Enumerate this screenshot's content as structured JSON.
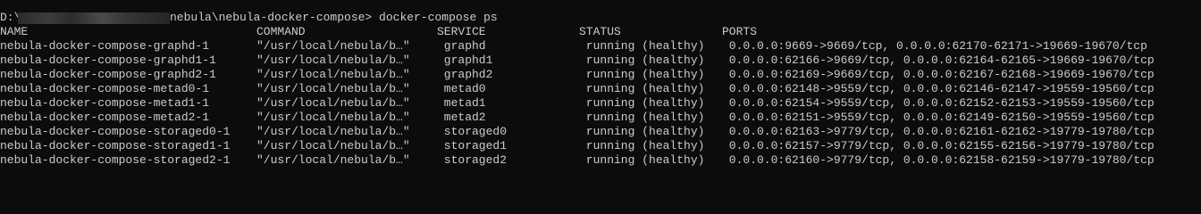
{
  "prompt": {
    "drive": "D:\\",
    "path_rest": "nebula\\nebula-docker-compose>",
    "command": " docker-compose ps"
  },
  "table": {
    "headers": {
      "name": "NAME",
      "command": "COMMAND",
      "service": "SERVICE",
      "status": "STATUS",
      "ports": "PORTS"
    },
    "rows": [
      {
        "name": "nebula-docker-compose-graphd-1",
        "command": "\"/usr/local/nebula/b…\"",
        "service": " graphd",
        "status": " running (healthy)",
        "ports": " 0.0.0.0:9669->9669/tcp, 0.0.0.0:62170-62171->19669-19670/tcp"
      },
      {
        "name": "nebula-docker-compose-graphd1-1",
        "command": "\"/usr/local/nebula/b…\"",
        "service": " graphd1",
        "status": " running (healthy)",
        "ports": " 0.0.0.0:62166->9669/tcp, 0.0.0.0:62164-62165->19669-19670/tcp"
      },
      {
        "name": "nebula-docker-compose-graphd2-1",
        "command": "\"/usr/local/nebula/b…\"",
        "service": " graphd2",
        "status": " running (healthy)",
        "ports": " 0.0.0.0:62169->9669/tcp, 0.0.0.0:62167-62168->19669-19670/tcp"
      },
      {
        "name": "nebula-docker-compose-metad0-1",
        "command": "\"/usr/local/nebula/b…\"",
        "service": " metad0",
        "status": " running (healthy)",
        "ports": " 0.0.0.0:62148->9559/tcp, 0.0.0.0:62146-62147->19559-19560/tcp"
      },
      {
        "name": "nebula-docker-compose-metad1-1",
        "command": "\"/usr/local/nebula/b…\"",
        "service": " metad1",
        "status": " running (healthy)",
        "ports": " 0.0.0.0:62154->9559/tcp, 0.0.0.0:62152-62153->19559-19560/tcp"
      },
      {
        "name": "nebula-docker-compose-metad2-1",
        "command": "\"/usr/local/nebula/b…\"",
        "service": " metad2",
        "status": " running (healthy)",
        "ports": " 0.0.0.0:62151->9559/tcp, 0.0.0.0:62149-62150->19559-19560/tcp"
      },
      {
        "name": "nebula-docker-compose-storaged0-1",
        "command": "\"/usr/local/nebula/b…\"",
        "service": " storaged0",
        "status": " running (healthy)",
        "ports": " 0.0.0.0:62163->9779/tcp, 0.0.0.0:62161-62162->19779-19780/tcp"
      },
      {
        "name": "nebula-docker-compose-storaged1-1",
        "command": "\"/usr/local/nebula/b…\"",
        "service": " storaged1",
        "status": " running (healthy)",
        "ports": " 0.0.0.0:62157->9779/tcp, 0.0.0.0:62155-62156->19779-19780/tcp"
      },
      {
        "name": "nebula-docker-compose-storaged2-1",
        "command": "\"/usr/local/nebula/b…\"",
        "service": " storaged2",
        "status": " running (healthy)",
        "ports": " 0.0.0.0:62160->9779/tcp, 0.0.0.0:62158-62159->19779-19780/tcp"
      }
    ]
  },
  "colors": {
    "background": "#0c0c0c",
    "foreground": "#cccccc"
  }
}
